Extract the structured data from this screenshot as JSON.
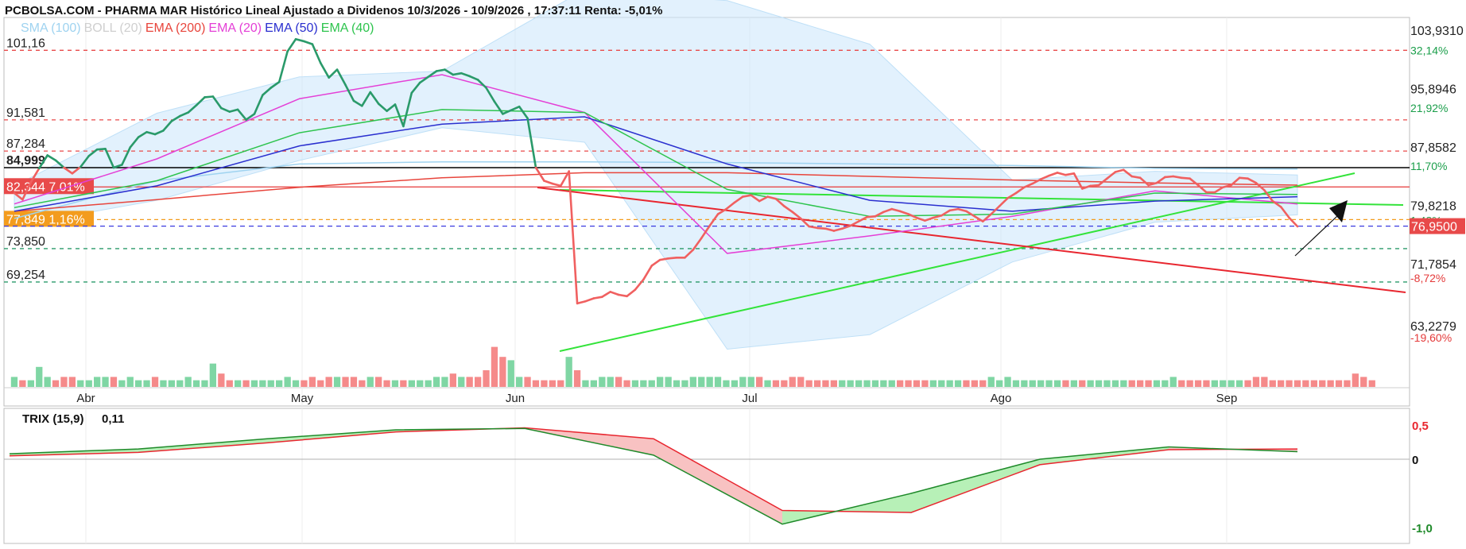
{
  "title": "PCBOLSA.COM - PHARMA MAR Histórico Lineal Ajustado a Dividenos 10/3/2026 - 10/9/2026 , 17:37:11 Renta: -5,01%",
  "legend": [
    {
      "label": "SMA (100)",
      "color": "#9fd3f0"
    },
    {
      "label": "BOLL (20)",
      "color": "#cfcfcf"
    },
    {
      "label": "EMA (200)",
      "color": "#e8453c"
    },
    {
      "label": "EMA (20)",
      "color": "#e43fd6"
    },
    {
      "label": "EMA (50)",
      "color": "#2a2fcf"
    },
    {
      "label": "EMA (40)",
      "color": "#2ec44e"
    }
  ],
  "price_axis": [
    {
      "label": "103,9310",
      "value": 103.931
    },
    {
      "label": "95,8946",
      "value": 95.8946
    },
    {
      "label": "87,8582",
      "value": 87.8582
    },
    {
      "label": "79,8218",
      "value": 79.8218
    },
    {
      "label": "71,7854",
      "value": 71.7854
    },
    {
      "label": "63,2279",
      "value": 63.2279
    }
  ],
  "pct_axis": [
    {
      "label": "32,14%",
      "value": 101.16,
      "color": "#1a9e4a"
    },
    {
      "label": "21,92%",
      "value": 93.2,
      "color": "#1a9e4a"
    },
    {
      "label": "11,70%",
      "value": 85.2,
      "color": "#1a9e4a"
    },
    {
      "label": "1,48%",
      "value": 77.7,
      "color": "#1a9e4a"
    },
    {
      "label": "-8,72%",
      "value": 69.8,
      "color": "#e43a3a"
    },
    {
      "label": "-19,60%",
      "value": 61.6,
      "color": "#e43a3a"
    }
  ],
  "last_price": {
    "label": "76,9500",
    "value": 76.95,
    "color": "#e84a4a"
  },
  "levels": [
    {
      "label": "101,16",
      "value": 101.16,
      "color": "#e84a4a",
      "style": "dash"
    },
    {
      "label": "91,581",
      "value": 91.581,
      "color": "#e84a4a",
      "style": "dash"
    },
    {
      "label": "87,284",
      "value": 87.284,
      "color": "#e84a4a",
      "style": "dash"
    },
    {
      "label": "84,999",
      "value": 84.999,
      "color": "#000000",
      "style": "solid"
    },
    {
      "label": "73,850",
      "value": 73.85,
      "color": "#2a9a6a",
      "style": "dash"
    },
    {
      "label": "69,254",
      "value": 69.254,
      "color": "#2a9a6a",
      "style": "dash"
    }
  ],
  "box_levels": [
    {
      "label": "82,344  7,01%",
      "value": 82.344,
      "bg": "#e84a4a",
      "line": "#e84a4a"
    },
    {
      "label": "77,849  1,16%",
      "value": 77.849,
      "bg": "#f39c1e",
      "line": "#f39c1e"
    }
  ],
  "months": [
    "Abr",
    "May",
    "Jun",
    "Jul",
    "Ago",
    "Sep"
  ],
  "trix": {
    "label": "TRIX (15,9)",
    "value": "0,11",
    "ticks": [
      "0,5",
      "0",
      "-1,0"
    ]
  },
  "chart_data": {
    "type": "line",
    "x_start": "2026-03-10",
    "x_end": "2026-09-10",
    "ylim": [
      63.2279,
      103.931
    ],
    "series": [
      {
        "name": "",
        "color_up": "#2a9a6a",
        "color_down": "#f06060",
        "values": [
          81.5,
          80.6,
          83.0,
          84.9,
          86.7,
          86.0,
          85.0,
          84.2,
          85.1,
          86.6,
          87.5,
          87.6,
          85.0,
          85.4,
          87.8,
          89.2,
          89.9,
          89.6,
          90.1,
          91.4,
          92.1,
          92.6,
          93.6,
          94.7,
          94.8,
          93.2,
          92.7,
          93.0,
          91.6,
          92.4,
          95.0,
          96.0,
          96.8,
          101.0,
          102.7,
          102.4,
          102.0,
          99.4,
          97.4,
          98.5,
          96.4,
          94.2,
          93.5,
          95.4,
          93.8,
          92.8,
          93.7,
          90.7,
          95.3,
          96.7,
          97.5,
          98.3,
          98.5,
          97.8,
          98.0,
          97.6,
          97.1,
          96.0,
          94.1,
          92.4,
          92.9,
          93.4,
          91.8,
          85.0,
          83.2,
          82.8,
          82.5,
          84.5,
          66.3,
          66.6,
          67.0,
          67.2,
          67.9,
          67.5,
          67.3,
          68.2,
          69.6,
          71.5,
          72.3,
          72.5,
          72.6,
          72.6,
          73.7,
          75.3,
          77.0,
          78.6,
          79.3,
          80.2,
          81.0,
          81.2,
          80.4,
          81.0,
          80.7,
          79.7,
          78.9,
          78.0,
          76.9,
          76.7,
          76.6,
          76.3,
          76.6,
          77.0,
          77.6,
          78.2,
          78.3,
          78.9,
          79.3,
          79.0,
          78.6,
          78.1,
          77.7,
          78.1,
          78.4,
          79.1,
          79.3,
          79.0,
          78.3,
          77.6,
          78.6,
          79.7,
          80.8,
          81.5,
          82.3,
          82.8,
          83.4,
          83.9,
          84.3,
          84.0,
          84.2,
          82.1,
          82.5,
          82.6,
          83.5,
          84.4,
          84.7,
          83.8,
          83.6,
          82.6,
          82.9,
          83.7,
          83.8,
          83.6,
          83.5,
          82.6,
          81.6,
          81.6,
          82.3,
          82.6,
          83.6,
          83.5,
          82.9,
          81.9,
          80.4,
          79.6,
          78.1,
          76.9
        ]
      },
      {
        "name": "",
        "color": "#9fd3f0",
        "values": [
          78.0,
          83.2,
          85.5,
          85.8,
          85.8,
          85.7,
          85.5,
          85.3,
          84.9,
          84.8
        ]
      },
      {
        "name": "",
        "color": "#e8453c",
        "values": [
          79.0,
          80.6,
          82.3,
          83.6,
          84.3,
          84.3,
          83.8,
          83.3,
          82.9,
          82.6
        ]
      },
      {
        "name": "",
        "color": "#e43fd6",
        "values": [
          80.0,
          86.2,
          94.5,
          97.8,
          92.6,
          73.2,
          75.6,
          78.3,
          81.8,
          80.0
        ]
      },
      {
        "name": "",
        "color": "#2a2fcf",
        "values": [
          79.0,
          82.5,
          88.0,
          91.0,
          92.0,
          85.5,
          80.5,
          79.0,
          80.4,
          81.0
        ]
      },
      {
        "name": "",
        "color": "#2ec44e",
        "values": [
          79.5,
          83.2,
          89.8,
          93.0,
          92.6,
          82.0,
          78.3,
          78.6,
          81.5,
          81.3
        ]
      }
    ],
    "bollinger": {
      "upper": [
        82.5,
        92.5,
        97.5,
        98.3,
        109.5,
        108.0,
        102.0,
        83.3,
        84.5,
        84.0
      ],
      "lower": [
        77.0,
        80.5,
        86.0,
        90.5,
        88.5,
        60.0,
        62.0,
        72.0,
        77.5,
        78.5
      ]
    },
    "volume": [
      3,
      2,
      2,
      6,
      3,
      2,
      3,
      3,
      2,
      2,
      3,
      3,
      3,
      2,
      3,
      2,
      2,
      3,
      2,
      2,
      2,
      3,
      2,
      2,
      7,
      4,
      2,
      2,
      2,
      2,
      2,
      2,
      2,
      3,
      2,
      2,
      3,
      2,
      3,
      3,
      3,
      3,
      2,
      3,
      3,
      2,
      2,
      2,
      2,
      2,
      2,
      3,
      3,
      4,
      3,
      3,
      3,
      5,
      12,
      9,
      8,
      3,
      3,
      2,
      2,
      2,
      2,
      9,
      5,
      2,
      2,
      3,
      3,
      3,
      2,
      2,
      2,
      2,
      3,
      3,
      2,
      2,
      3,
      3,
      3,
      3,
      2,
      2,
      3,
      3,
      3,
      2,
      2,
      2,
      3,
      3,
      2,
      2,
      2,
      2,
      2,
      2,
      2,
      2,
      2,
      2,
      2,
      2,
      2,
      2,
      2,
      2,
      2,
      2,
      2,
      2,
      2,
      2,
      3,
      2,
      3,
      2,
      2,
      2,
      2,
      2,
      2,
      2,
      2,
      2,
      2,
      2,
      2,
      2,
      2,
      2,
      2,
      2,
      2,
      2,
      3,
      2,
      2,
      2,
      2,
      2,
      2,
      2,
      2,
      2,
      3,
      3,
      2,
      2,
      2,
      2,
      2,
      2,
      2,
      2,
      2,
      2,
      4,
      3,
      2
    ],
    "trix_series": {
      "trix": [
        0.08,
        0.15,
        0.3,
        0.43,
        0.45,
        0.06,
        -0.95,
        -0.5,
        0.0,
        0.18,
        0.11
      ],
      "signal": [
        0.05,
        0.1,
        0.24,
        0.4,
        0.46,
        0.3,
        -0.75,
        -0.78,
        -0.08,
        0.14,
        0.15
      ]
    }
  }
}
